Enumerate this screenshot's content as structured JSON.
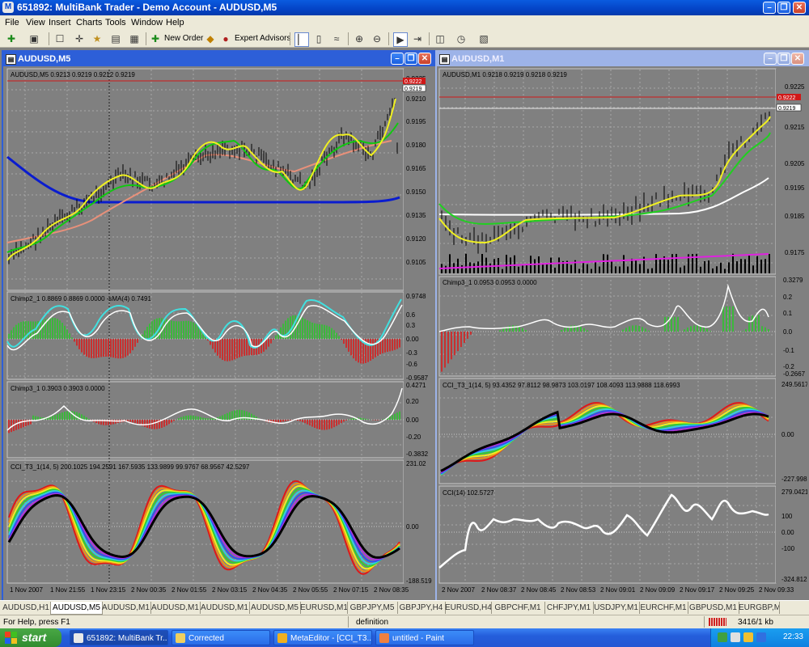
{
  "app": {
    "title": "651892: MultiBank Trader - Demo Account - AUDUSD,M5",
    "logo_letter": "M"
  },
  "menu": [
    "File",
    "View",
    "Insert",
    "Charts",
    "Tools",
    "Window",
    "Help"
  ],
  "toolbar": {
    "new_order": "New Order",
    "expert_advisors": "Expert Advisors"
  },
  "windows": {
    "left": {
      "title": "AUDUSD,M5",
      "main_info": "AUDUSD,M5  0.9213 0.9219 0.9212 0.9219",
      "price_ticks": [
        "0.9225",
        "0.9210",
        "0.9195",
        "0.9180",
        "0.9165",
        "0.9150",
        "0.9135",
        "0.9120",
        "0.9105"
      ],
      "red_tag": "0.9222",
      "price_tag": "0.9219",
      "chimp2_info": "Chimp2_1 0.8869 0.8869 0.0000  -sMA(4) 0.7491",
      "chimp2_ticks": [
        "0.9748",
        "0.6",
        "0.3",
        "0.00",
        "-0.3",
        "-0.6",
        "-0.9587"
      ],
      "chimp3_info": "Chimp3_1 0.3903 0.3903 0.0000",
      "chimp3_ticks": [
        "0.4271",
        "0.20",
        "0.00",
        "-0.20",
        "-0.3832"
      ],
      "cci_info": "CCI_T3_1(14, 5) 200.1025 194.2591 167.5935 133.9899 99.9767 68.9567 42.5297",
      "cci_ticks": [
        "231.02",
        "0.00",
        "-188.519"
      ],
      "time_labels": [
        "1 Nov 2007",
        "1 Nov 21:55",
        "1 Nov 23:15",
        "2 Nov 00:35",
        "2 Nov 01:55",
        "2 Nov 03:15",
        "2 Nov 04:35",
        "2 Nov 05:55",
        "2 Nov 07:15",
        "2 Nov 08:35"
      ]
    },
    "right": {
      "title": "AUDUSD,M1",
      "main_info": "AUDUSD,M1  0.9218 0.9219 0.9218 0.9219",
      "price_ticks": [
        "0.9225",
        "0.9215",
        "0.9205",
        "0.9195",
        "0.9185",
        "0.9175"
      ],
      "red_tag": "0.9222",
      "price_tag": "0.9219",
      "chimp3_info": "Chimp3_1 0.0953 0.0953 0.0000",
      "chimp3_ticks": [
        "0.3279",
        "0.2",
        "0.1",
        "0.0",
        "-0.1",
        "-0.2",
        "-0.2667"
      ],
      "cci_t3_info": "CCI_T3_1(14, 5) 93.4352 97.8112 98.9873 103.0197 108.4093 113.9888 118.6993",
      "cci_t3_ticks": [
        "249.5617",
        "0.00",
        "-227.998"
      ],
      "cci_info": "CCI(14) 102.5727",
      "cci_ticks": [
        "279.0421",
        "100",
        "0.00",
        "-100",
        "-324.812"
      ],
      "time_labels": [
        "2 Nov 2007",
        "2 Nov 08:37",
        "2 Nov 08:45",
        "2 Nov 08:53",
        "2 Nov 09:01",
        "2 Nov 09:09",
        "2 Nov 09:17",
        "2 Nov 09:25",
        "2 Nov 09:33"
      ]
    }
  },
  "tabs": [
    "AUDUSD,H1",
    "AUDUSD,M5",
    "AUDUSD,M1",
    "AUDUSD,M1",
    "AUDUSD,M1",
    "AUDUSD,M5",
    "EURUSD,M1",
    "GBPJPY,M5",
    "GBPJPY,H4",
    "EURUSD,H4",
    "GBPCHF,M1",
    "CHFJPY,M1",
    "USDJPY,M1",
    "EURCHF,M1",
    "GBPUSD,M1",
    "EURGBP,M"
  ],
  "active_tab": 1,
  "status": {
    "help": "For Help, press F1",
    "mode": "definition",
    "traffic": "3416/1 kb"
  },
  "taskbar": {
    "start": "start",
    "tasks": [
      "651892: MultiBank Tr...",
      "Corrected",
      "MetaEditor - [CCI_T3...",
      "untitled - Paint"
    ],
    "clock": "22:33"
  }
}
